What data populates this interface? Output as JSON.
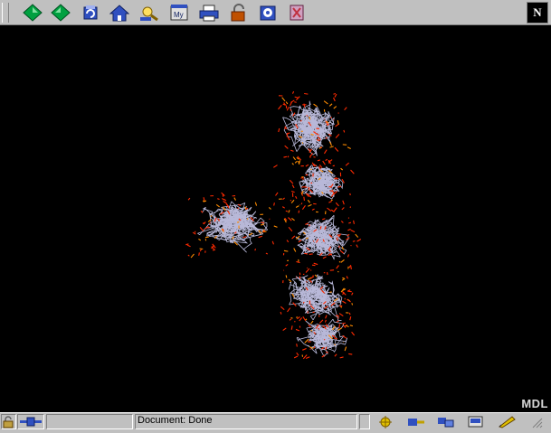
{
  "toolbar": {
    "buttons": [
      {
        "icon": "back-arrow-icon",
        "color": "#00a040"
      },
      {
        "icon": "forward-arrow-icon",
        "color": "#00a040"
      },
      {
        "icon": "reload-icon",
        "color": "#3050c0"
      },
      {
        "icon": "home-icon",
        "color": "#3050c0"
      },
      {
        "icon": "search-icon",
        "color": "#c0a000"
      },
      {
        "icon": "my-netscape-icon",
        "label": "My",
        "color": "#3050c0"
      },
      {
        "icon": "print-icon",
        "color": "#3050c0"
      },
      {
        "icon": "security-lock-icon",
        "color": "#c05000"
      },
      {
        "icon": "shop-icon",
        "color": "#3050c0"
      },
      {
        "icon": "stop-icon",
        "color": "#c03040"
      }
    ],
    "logo_letter": "N"
  },
  "viewer": {
    "watermark": "MDL",
    "molecule_colors": {
      "backbone": "#b8b8d8",
      "oxygen": "#ff2a00",
      "phosphorus": "#ff8c00"
    }
  },
  "status_bar": {
    "document_status": "Document: Done"
  }
}
